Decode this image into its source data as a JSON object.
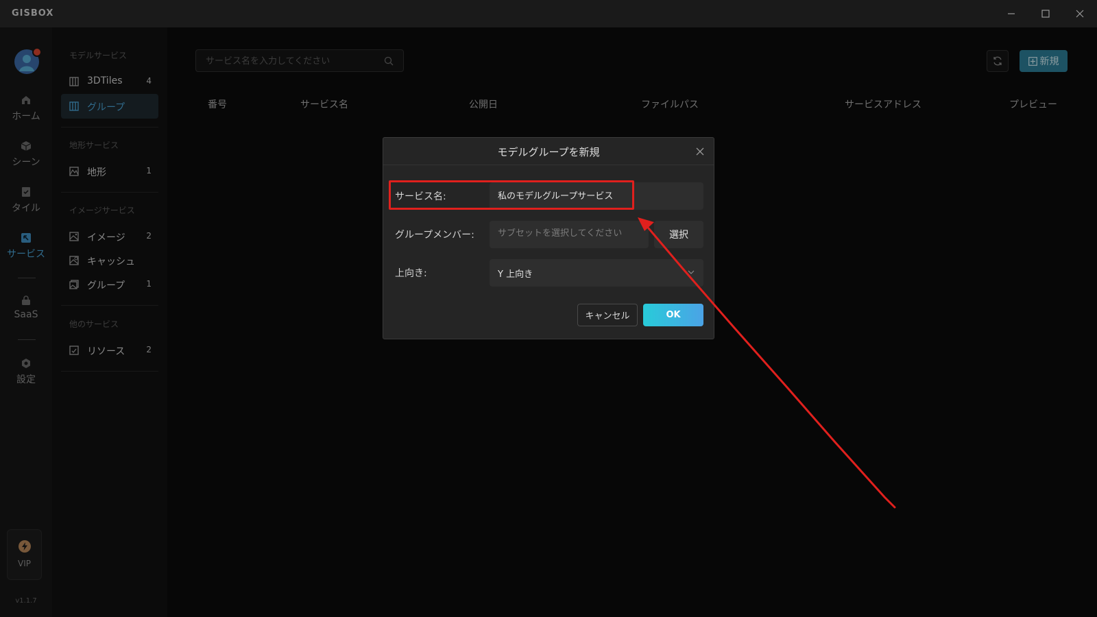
{
  "window": {
    "app_logo": "GISBOX"
  },
  "rail": {
    "items": [
      {
        "label": "ホーム",
        "icon": "home-icon"
      },
      {
        "label": "シーン",
        "icon": "scene-icon"
      },
      {
        "label": "タイル",
        "icon": "tile-icon"
      },
      {
        "label": "サービス",
        "icon": "service-icon",
        "active": true
      },
      {
        "label": "SaaS",
        "icon": "saas-icon"
      },
      {
        "label": "設定",
        "icon": "settings-icon"
      }
    ],
    "vip_label": "VIP",
    "version": "v1.1.7"
  },
  "sidebar": {
    "groups": [
      {
        "title": "モデルサービス",
        "items": [
          {
            "label": "3DTiles",
            "count": "4"
          },
          {
            "label": "グループ",
            "count": "",
            "active": true
          }
        ]
      },
      {
        "title": "地形サービス",
        "items": [
          {
            "label": "地形",
            "count": "1"
          }
        ]
      },
      {
        "title": "イメージサービス",
        "items": [
          {
            "label": "イメージ",
            "count": "2"
          },
          {
            "label": "キャッシュ",
            "count": ""
          },
          {
            "label": "グループ",
            "count": "1"
          }
        ]
      },
      {
        "title": "他のサービス",
        "items": [
          {
            "label": "リソース",
            "count": "2"
          }
        ]
      }
    ]
  },
  "main": {
    "search_placeholder": "サービス名を入力してください",
    "new_label": "新規",
    "columns": [
      "番号",
      "サービス名",
      "公開日",
      "ファイルパス",
      "サービスアドレス",
      "プレビュー"
    ]
  },
  "modal": {
    "title": "モデルグループを新規",
    "service_name_label": "サービス名:",
    "service_name_value": "私のモデルグループサービス",
    "members_label": "グループメンバー:",
    "members_placeholder": "サブセットを選択してください",
    "select_label": "選択",
    "up_label": "上向き:",
    "up_value": "Y 上向き",
    "cancel_label": "キャンセル",
    "ok_label": "OK"
  },
  "colors": {
    "accent": "#4aa3d6",
    "new_button": "#2d7f99",
    "annotation": "#e0201d",
    "ok_gradient_start": "#28cbd9",
    "ok_gradient_end": "#4ba3e6"
  }
}
